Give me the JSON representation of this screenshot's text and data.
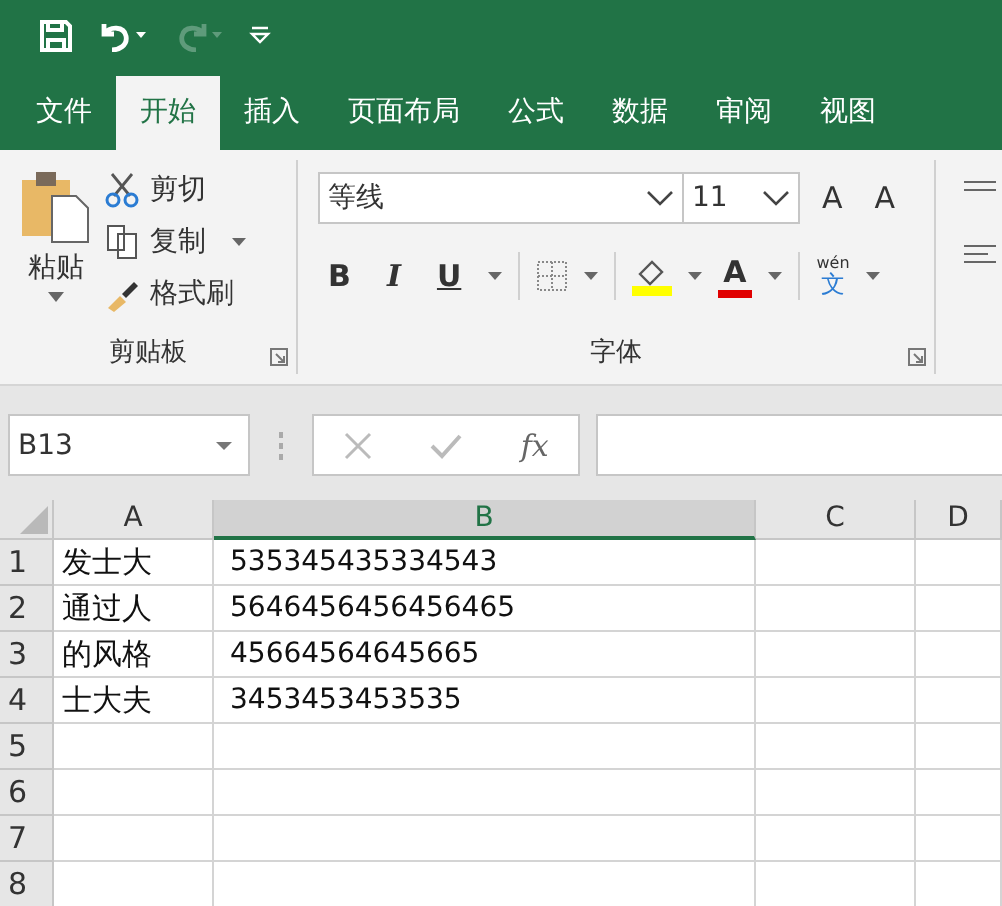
{
  "quick_access": [
    {
      "kind": "save",
      "disabled": false
    },
    {
      "kind": "undo",
      "disabled": false
    },
    {
      "kind": "redo",
      "disabled": true
    },
    {
      "kind": "customize",
      "disabled": false
    }
  ],
  "tabs": [
    {
      "label": "文件",
      "selected": false
    },
    {
      "label": "开始",
      "selected": true
    },
    {
      "label": "插入",
      "selected": false
    },
    {
      "label": "页面布局",
      "selected": false
    },
    {
      "label": "公式",
      "selected": false
    },
    {
      "label": "数据",
      "selected": false
    },
    {
      "label": "审阅",
      "selected": false
    },
    {
      "label": "视图",
      "selected": false
    }
  ],
  "clipboard": {
    "paste": "粘贴",
    "cut": "剪切",
    "copy": "复制",
    "format_painter": "格式刷",
    "group_label": "剪贴板"
  },
  "font": {
    "font_name": "等线",
    "font_size": "11",
    "grow": "A",
    "shrink": "A",
    "bold": "B",
    "italic": "I",
    "underline": "U",
    "font_color": "A",
    "phonetic_top": "wén",
    "phonetic_bottom": "文",
    "group_label": "字体"
  },
  "formula_bar": {
    "name_box": "B13",
    "function": "fx"
  },
  "columns": [
    {
      "label": "A",
      "selected": false
    },
    {
      "label": "B",
      "selected": true
    },
    {
      "label": "C",
      "selected": false
    },
    {
      "label": "D",
      "selected": false
    }
  ],
  "rows": [
    {
      "label": "1",
      "cells": [
        "发士大",
        "535345435334543"
      ]
    },
    {
      "label": "2",
      "cells": [
        "通过人",
        "5646456456456465"
      ]
    },
    {
      "label": "3",
      "cells": [
        "的风格",
        "45664564645665"
      ]
    },
    {
      "label": "4",
      "cells": [
        "士大夫",
        "3453453453535"
      ]
    },
    {
      "label": "5",
      "cells": []
    },
    {
      "label": "6",
      "cells": []
    },
    {
      "label": "7",
      "cells": []
    },
    {
      "label": "8",
      "cells": []
    }
  ]
}
